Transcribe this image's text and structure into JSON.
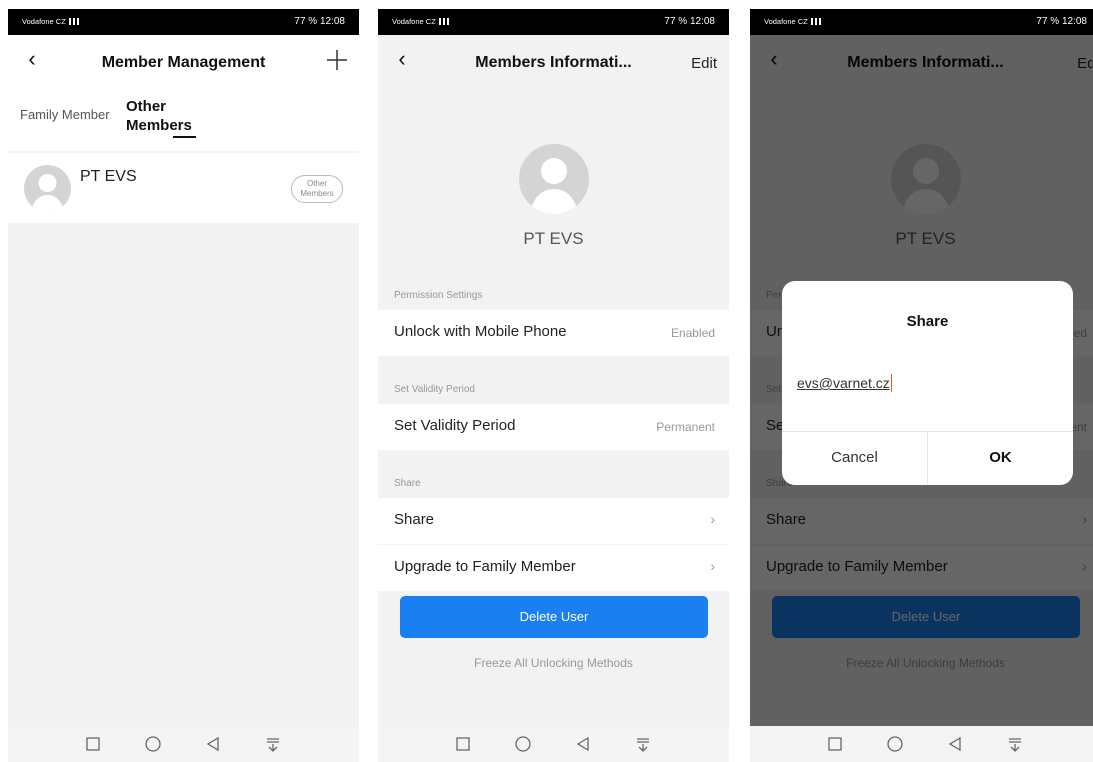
{
  "status": {
    "carrier": "Vodafone CZ",
    "battery": "77 %",
    "time": "12:08"
  },
  "screen1": {
    "title": "Member Management",
    "tabs": [
      "Family Member",
      "Other Members"
    ],
    "member": {
      "name": "PT EVS",
      "badge": "Other Members"
    }
  },
  "screen2": {
    "title": "Members Informati...",
    "edit_label": "Edit",
    "name": "PT EVS",
    "sections": {
      "permission": "Permission Settings",
      "validity": "Set Validity Period",
      "share": "Share"
    },
    "rows": {
      "unlock": {
        "label": "Unlock with Mobile Phone",
        "value": "Enabled"
      },
      "validity": {
        "label": "Set Validity Period",
        "value": "Permanent"
      },
      "share": {
        "label": "Share"
      },
      "upgrade": {
        "label": "Upgrade to Family Member"
      }
    },
    "delete_label": "Delete User",
    "freeze_label": "Freeze All Unlocking Methods"
  },
  "dialog": {
    "title": "Share",
    "input_value": "evs@varnet.cz",
    "cancel_label": "Cancel",
    "ok_label": "OK"
  },
  "icons": {
    "back": "chevron-left-icon",
    "add": "plus-icon",
    "chevron": "chevron-right-icon",
    "nav": [
      "square-icon",
      "circle-icon",
      "triangle-back-icon",
      "download-icon"
    ]
  },
  "colors": {
    "accent": "#1a7ff0",
    "caret": "#e2582e"
  }
}
